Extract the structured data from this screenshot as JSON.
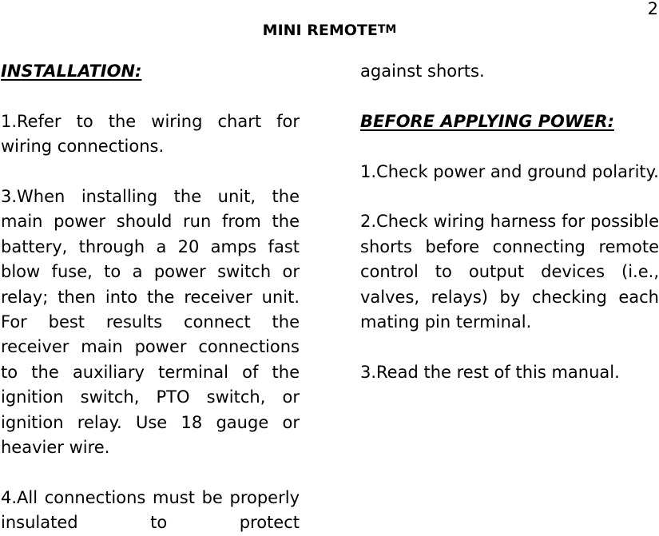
{
  "page_number": "2",
  "title": {
    "text": "MINI REMOTE",
    "trademark": "TM"
  },
  "left_column": {
    "heading": "INSTALLATION:",
    "items": [
      "1.Refer to the wiring chart for wiring connections.",
      "3.When installing the unit, the main power should run from the battery, through a 20 amps fast blow fuse, to a power switch or relay; then into the receiver unit.  For best results connect the receiver main power connections to the auxiliary terminal of the ignition switch, PTO switch, or ignition relay.  Use 18 gauge or heavier wire.",
      "4.All connections must be properly insulated to protect"
    ]
  },
  "right_column": {
    "continuation": "against shorts.",
    "heading": "BEFORE APPLYING POWER:",
    "items": [
      "1.Check power and ground polarity.",
      "2.Check wiring harness for possible shorts before connecting remote control to output devices (i.e., valves, relays) by checking each mating pin terminal.",
      "3.Read the rest of this manual."
    ]
  }
}
